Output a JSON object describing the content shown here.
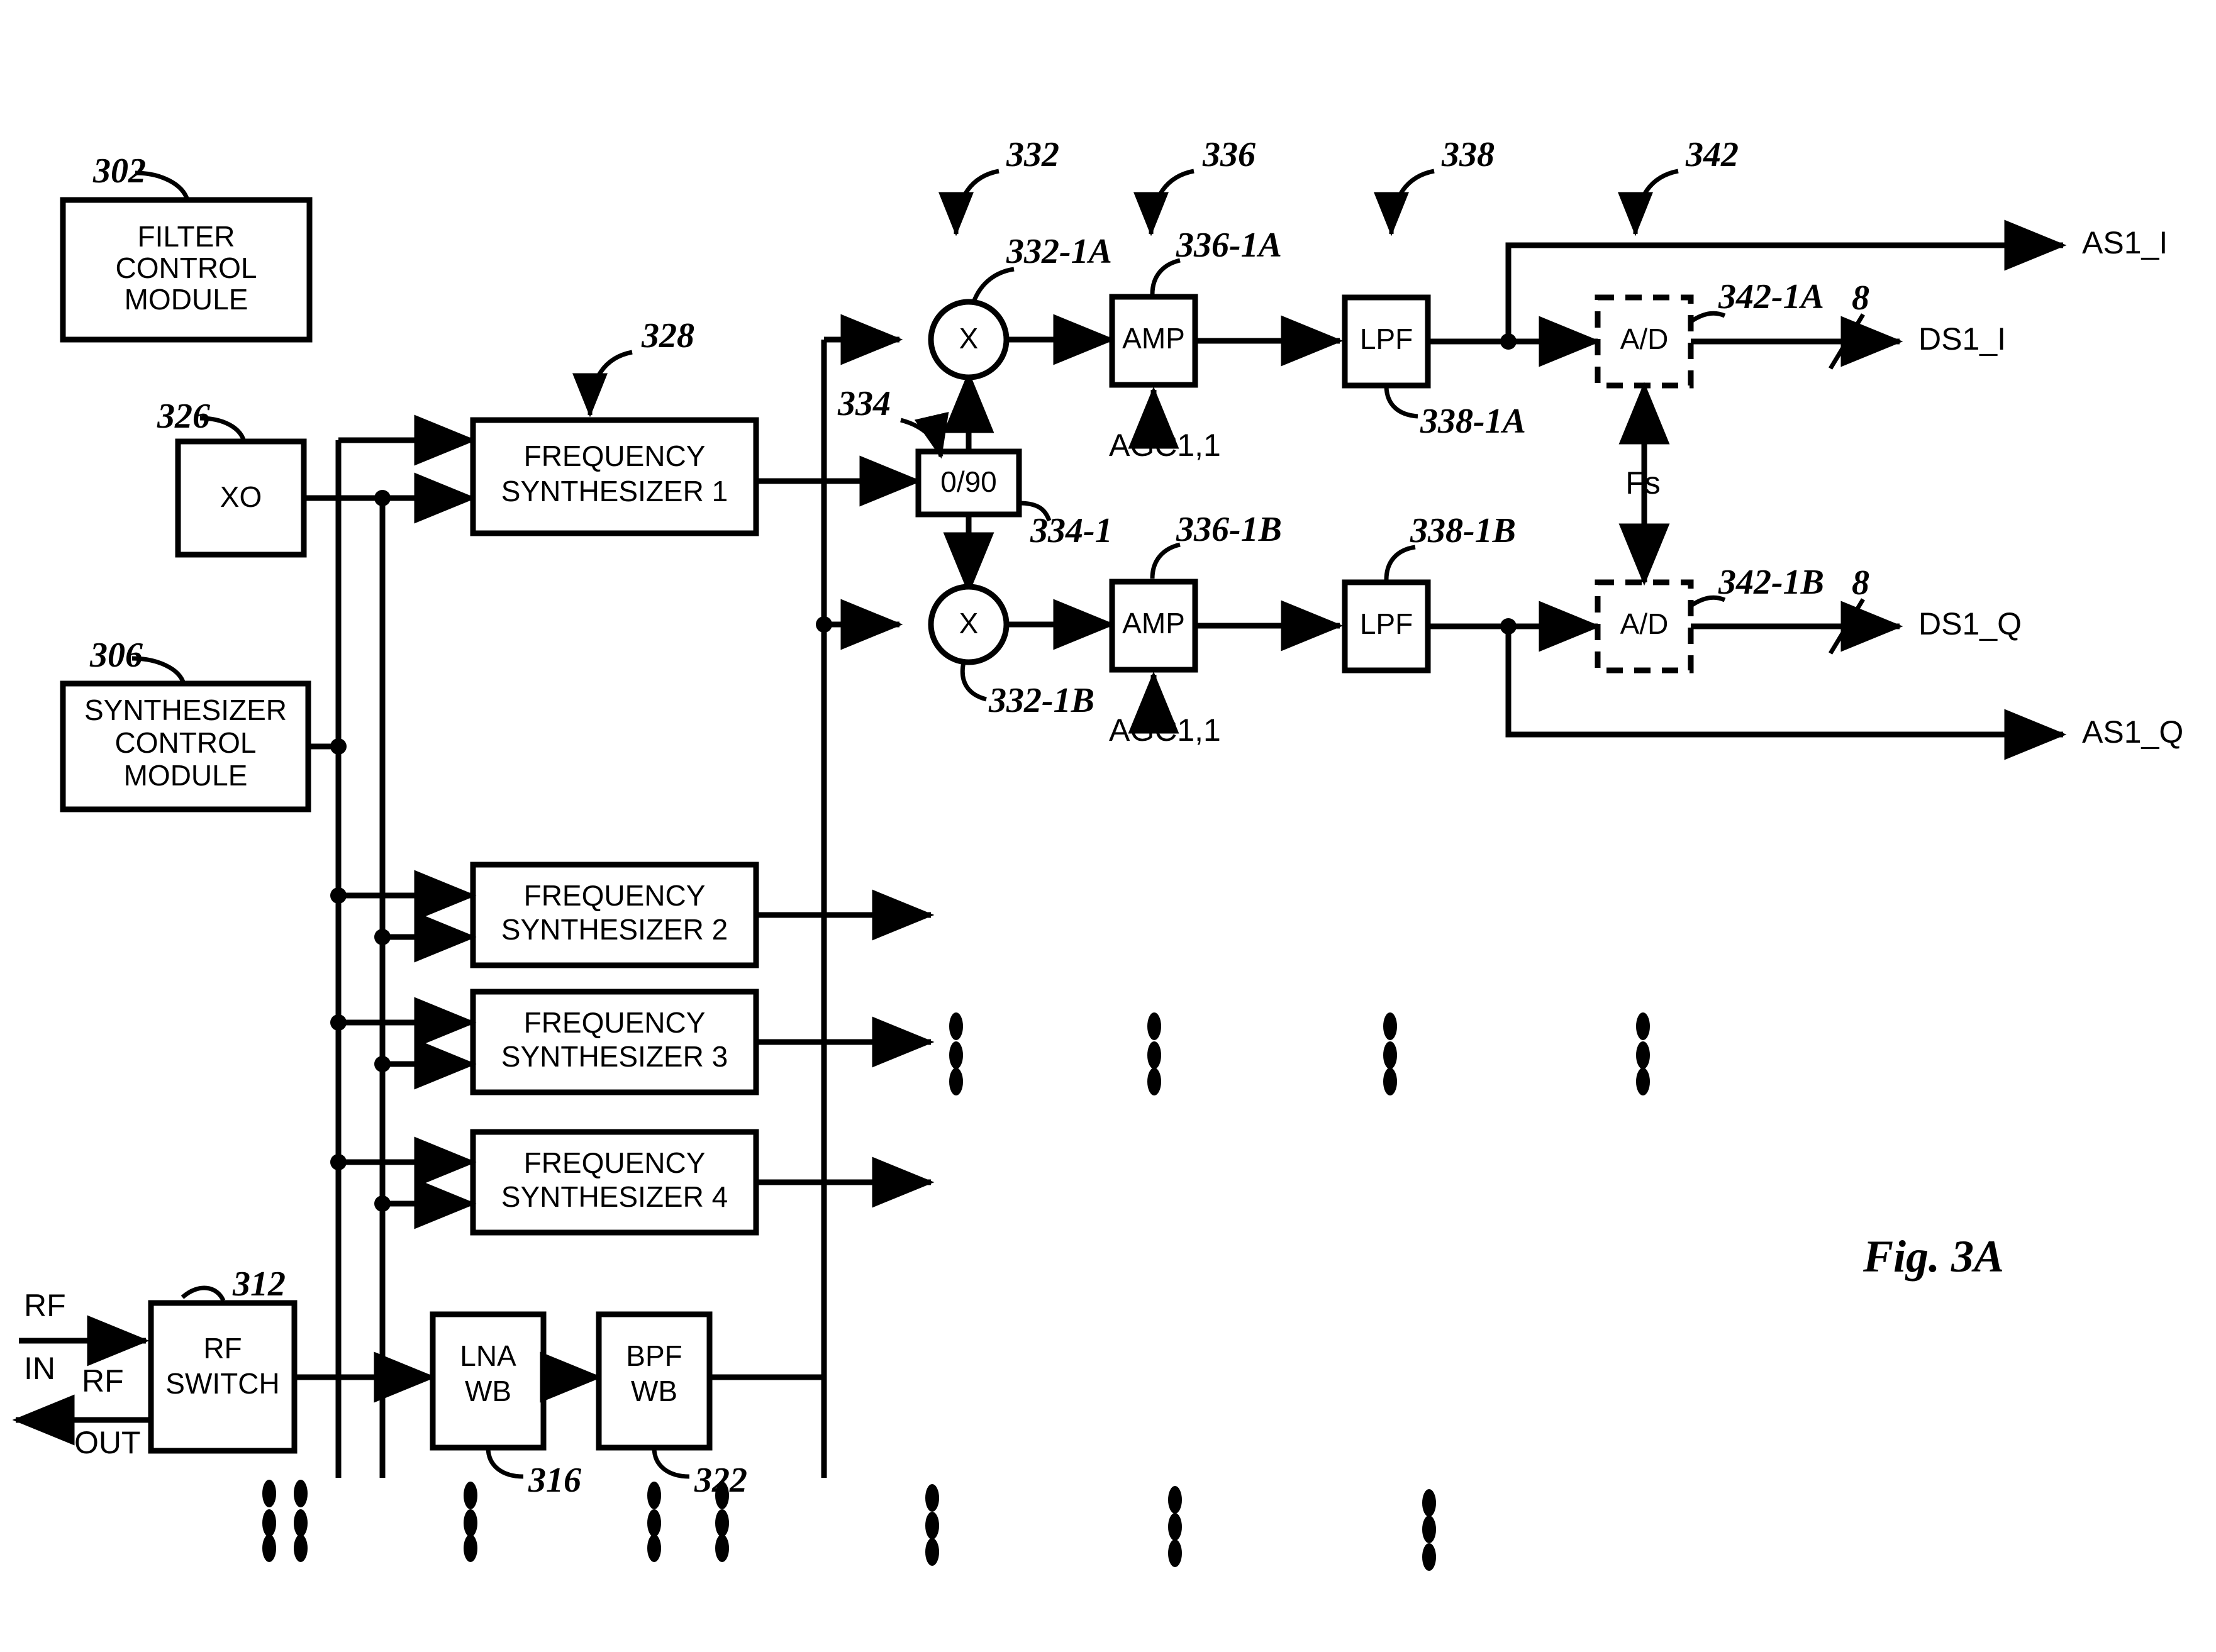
{
  "figure": {
    "caption": "Fig.  3A"
  },
  "blocks": {
    "filter_control_module": {
      "lines": [
        "FILTER",
        "CONTROL",
        "MODULE"
      ],
      "ref": "302"
    },
    "xo": {
      "label": "XO",
      "ref": "326"
    },
    "synthesizer_control_module": {
      "lines": [
        "SYNTHESIZER",
        "CONTROL",
        "MODULE"
      ],
      "ref": "306"
    },
    "freq_synth_1": {
      "lines": [
        "FREQUENCY",
        "SYNTHESIZER 1"
      ],
      "ref": "328"
    },
    "freq_synth_2": {
      "lines": [
        "FREQUENCY",
        "SYNTHESIZER 2"
      ]
    },
    "freq_synth_3": {
      "lines": [
        "FREQUENCY",
        "SYNTHESIZER 3"
      ]
    },
    "freq_synth_4": {
      "lines": [
        "FREQUENCY",
        "SYNTHESIZER 4"
      ]
    },
    "rf_switch": {
      "lines": [
        "RF",
        "SWITCH"
      ],
      "ref": "312"
    },
    "lna_wb": {
      "lines": [
        "LNA",
        "WB"
      ],
      "ref": "316"
    },
    "bpf_wb": {
      "lines": [
        "BPF",
        "WB"
      ],
      "ref": "322"
    },
    "phase_shifter": {
      "label": "0/90",
      "ref": "334-1",
      "group_ref": "334"
    },
    "mixer_i": {
      "label": "X",
      "ref": "332-1A"
    },
    "mixer_q": {
      "label": "X",
      "ref": "332-1B"
    },
    "amp_i": {
      "label": "AMP",
      "ref": "336-1A",
      "control": "AGC1,1"
    },
    "amp_q": {
      "label": "AMP",
      "ref": "336-1B",
      "control": "AGC1,1"
    },
    "lpf_i": {
      "label": "LPF",
      "ref": "338-1A"
    },
    "lpf_q": {
      "label": "LPF",
      "ref": "338-1B"
    },
    "adc_i": {
      "label": "A/D",
      "ref": "342-1A",
      "bus_width": "8"
    },
    "adc_q": {
      "label": "A/D",
      "ref": "342-1B",
      "bus_width": "8"
    }
  },
  "group_refs": {
    "mixers": "332",
    "amps": "336",
    "lpfs": "338",
    "adcs": "342"
  },
  "signals": {
    "rf_in": [
      "RF",
      "IN"
    ],
    "rf_out": [
      "RF",
      "OUT"
    ],
    "sample_clock": "Fs",
    "out_as1_i": "AS1_I",
    "out_ds1_i": "DS1_I",
    "out_ds1_q": "DS1_Q",
    "out_as1_q": "AS1_Q"
  },
  "colors": {
    "stroke": "#000000",
    "background": "#ffffff"
  }
}
